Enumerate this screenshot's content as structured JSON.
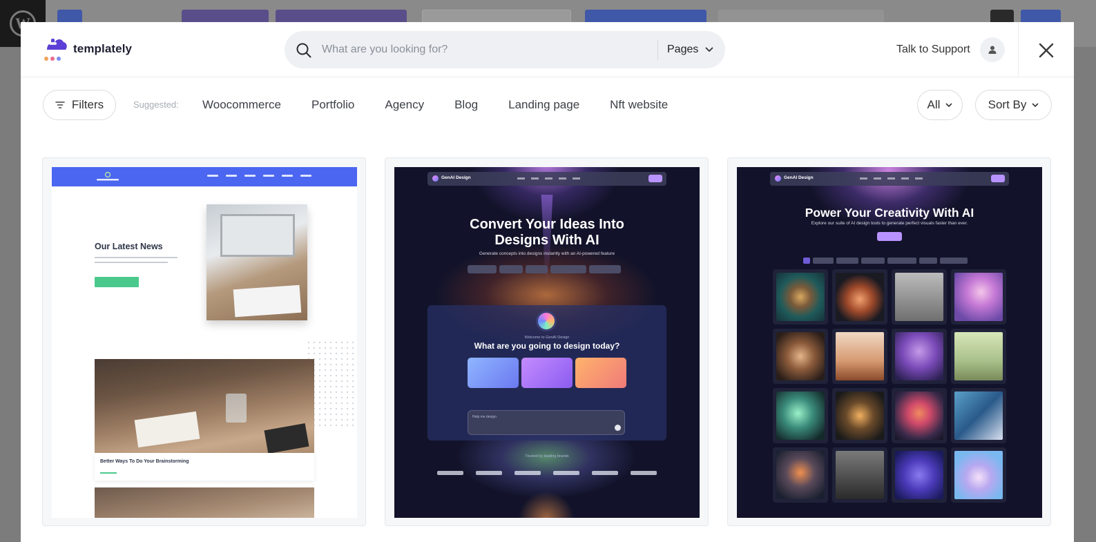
{
  "brand": {
    "name": "templately"
  },
  "search": {
    "placeholder": "What are you looking for?",
    "type_label": "Pages"
  },
  "support": {
    "label": "Talk to Support"
  },
  "filters": {
    "button_label": "Filters",
    "suggested_label": "Suggested:",
    "tags": [
      "Woocommerce",
      "Portfolio",
      "Agency",
      "Blog",
      "Landing page",
      "Nft website"
    ],
    "all_label": "All",
    "sort_label": "Sort By"
  },
  "cards": [
    {
      "heading": "Our Latest News",
      "caption": "Better Ways To Do Your Brainstorming"
    },
    {
      "headline_1": "Convert Your Ideas Into",
      "headline_2": "Designs With AI",
      "subtitle": "Generate concepts into designs instantly with an AI-powered feature",
      "brand": "GenAI Design",
      "question": "What are you going to design today?"
    },
    {
      "headline": "Power Your Creativity With AI",
      "subtitle": "Explore our suite of AI design tools to generate perfect visuals faster than ever.",
      "brand": "GenAI Design"
    }
  ],
  "colors": {
    "accent_purple": "#5b3fd6",
    "nav_blue": "#4b66f0",
    "cta_green": "#4ac98d",
    "dark_bg": "#12132a"
  }
}
